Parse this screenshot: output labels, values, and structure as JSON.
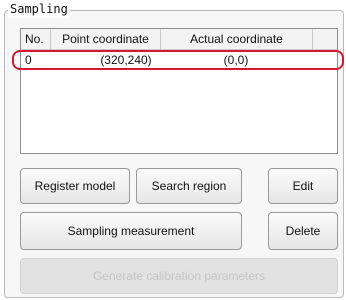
{
  "group": {
    "title": "Sampling"
  },
  "table": {
    "columns": [
      "No.",
      "Point coordinate",
      "Actual coordinate",
      ""
    ],
    "rows": [
      {
        "no": "0",
        "point": "(320,240)",
        "actual": "(0,0)"
      }
    ]
  },
  "buttons": {
    "register_model": "Register model",
    "search_region": "Search region",
    "edit": "Edit",
    "sampling_measurement": "Sampling measurement",
    "delete": "Delete",
    "generate_calibration": "Generate calibration parameters"
  },
  "colors": {
    "highlight": "#d7192e",
    "disabled_text": "#c4c4c4"
  }
}
